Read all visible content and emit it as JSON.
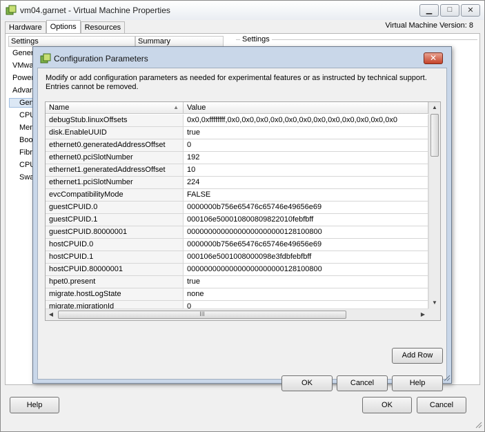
{
  "window": {
    "title": "vm04.garnet - Virtual Machine Properties",
    "version_label": "Virtual Machine Version: 8",
    "caption_minimize": "▁",
    "caption_maximize": "□",
    "caption_close": "✕"
  },
  "tabs": [
    {
      "label": "Hardware"
    },
    {
      "label": "Options",
      "active": true
    },
    {
      "label": "Resources"
    }
  ],
  "left_panel": {
    "col_settings": "Settings",
    "col_summary": "Summary",
    "items": [
      "Gener",
      "VMwa",
      "Power",
      "Advan",
      "Gen",
      "CPU",
      "Mem",
      "Boo",
      "Fibr",
      "CPU",
      "Swa"
    ],
    "selected_index": 4
  },
  "right_panel": {
    "group_label": "Settings"
  },
  "outer_buttons": {
    "help": "Help",
    "ok": "OK",
    "cancel": "Cancel"
  },
  "dialog": {
    "title": "Configuration Parameters",
    "close_glyph": "✕",
    "description": "Modify or add configuration parameters as needed for experimental features or as instructed by technical support. Entries cannot be removed.",
    "columns": {
      "name": "Name",
      "value": "Value"
    },
    "sort_glyph": "▲",
    "rows": [
      {
        "name": "debugStub.linuxOffsets",
        "value": "0x0,0xffffffff,0x0,0x0,0x0,0x0,0x0,0x0,0x0,0x0,0x0,0x0,0x0,0x0"
      },
      {
        "name": "disk.EnableUUID",
        "value": "true"
      },
      {
        "name": "ethernet0.generatedAddressOffset",
        "value": "0"
      },
      {
        "name": "ethernet0.pciSlotNumber",
        "value": "192"
      },
      {
        "name": "ethernet1.generatedAddressOffset",
        "value": "10"
      },
      {
        "name": "ethernet1.pciSlotNumber",
        "value": "224"
      },
      {
        "name": "evcCompatibilityMode",
        "value": "FALSE"
      },
      {
        "name": "guestCPUID.0",
        "value": "0000000b756e65476c65746e49656e69"
      },
      {
        "name": "guestCPUID.1",
        "value": "000106e500010800809822010febfbff"
      },
      {
        "name": "guestCPUID.80000001",
        "value": "00000000000000000000000128100800"
      },
      {
        "name": "hostCPUID.0",
        "value": "0000000b756e65476c65746e49656e69"
      },
      {
        "name": "hostCPUID.1",
        "value": "000106e5001008000098e3fdbfebfbff"
      },
      {
        "name": "hostCPUID.80000001",
        "value": "00000000000000000000000128100800"
      },
      {
        "name": "hpet0.present",
        "value": "true"
      },
      {
        "name": "migrate.hostLogState",
        "value": "none"
      },
      {
        "name": "migrate.migrationId",
        "value": "0"
      }
    ],
    "scroll_up": "▲",
    "scroll_down": "▼",
    "scroll_left": "◀",
    "scroll_right": "▶",
    "hscroll_grip": "III",
    "buttons": {
      "add_row": "Add Row",
      "ok": "OK",
      "cancel": "Cancel",
      "help": "Help"
    }
  },
  "icons": {
    "app_icon": "vm-puzzle-icon",
    "resize_grip": "resize-grip-icon"
  }
}
